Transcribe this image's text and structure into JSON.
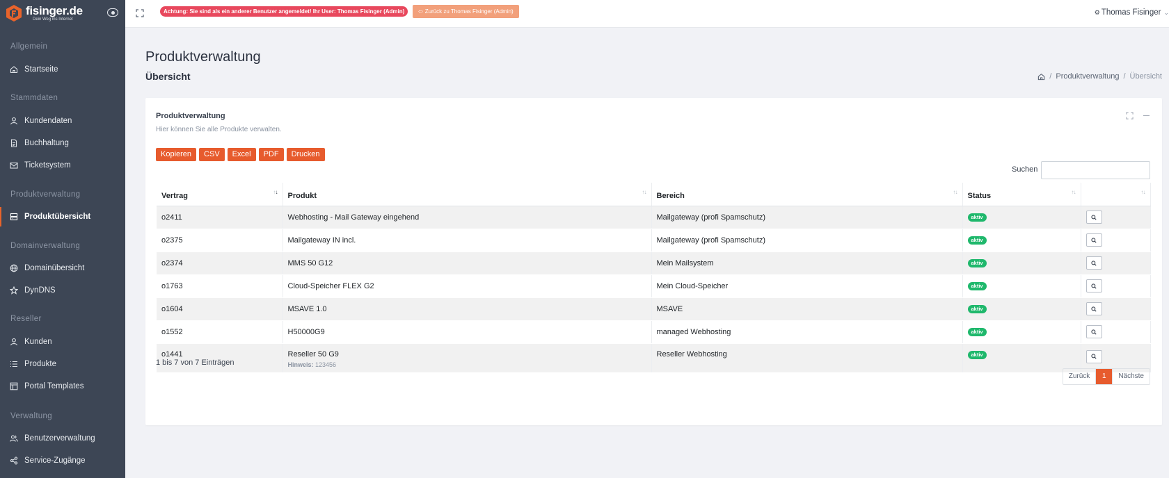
{
  "brand": {
    "name": "fisinger.de",
    "tagline": "Dein Weg ins Internet"
  },
  "topbar": {
    "warning": "Achtung: Sie sind als ein anderer Benutzer angemeldet! Ihr User: Thomas Fisinger (Admin)",
    "back_button": "Zurück zu Thomas Fisinger (Admin)",
    "user": "Thomas Fisinger"
  },
  "sidebar": {
    "sections": [
      {
        "label": "Allgemein"
      },
      {
        "label": "Stammdaten"
      },
      {
        "label": "Produktverwaltung"
      },
      {
        "label": "Domainverwaltung"
      },
      {
        "label": "Reseller"
      },
      {
        "label": "Verwaltung"
      }
    ],
    "items": [
      {
        "label": "Startseite",
        "icon": "home-icon"
      },
      {
        "label": "Kundendaten",
        "icon": "user-icon"
      },
      {
        "label": "Buchhaltung",
        "icon": "document-icon"
      },
      {
        "label": "Ticketsystem",
        "icon": "mail-icon"
      },
      {
        "label": "Produktübersicht",
        "icon": "server-icon",
        "active": true
      },
      {
        "label": "Domainübersicht",
        "icon": "globe-icon"
      },
      {
        "label": "DynDNS",
        "icon": "star-icon"
      },
      {
        "label": "Kunden",
        "icon": "user-icon"
      },
      {
        "label": "Produkte",
        "icon": "list-icon"
      },
      {
        "label": "Portal Templates",
        "icon": "layout-icon"
      },
      {
        "label": "Benutzerverwaltung",
        "icon": "users-icon"
      },
      {
        "label": "Service-Zugänge",
        "icon": "share-icon"
      }
    ]
  },
  "page": {
    "title": "Produktverwaltung",
    "subtitle": "Übersicht",
    "breadcrumb": [
      "Produktverwaltung",
      "Übersicht"
    ]
  },
  "card": {
    "title": "Produktverwaltung",
    "description": "Hier können Sie alle Produkte verwalten.",
    "export_buttons": [
      "Kopieren",
      "CSV",
      "Excel",
      "PDF",
      "Drucken"
    ],
    "search_label": "Suchen",
    "search_value": ""
  },
  "table": {
    "columns": [
      "Vertrag",
      "Produkt",
      "Bereich",
      "Status",
      ""
    ],
    "rows": [
      {
        "vertrag": "o2411",
        "produkt": "Webhosting - Mail Gateway eingehend",
        "bereich": "Mailgateway (profi Spamschutz)",
        "status": "aktiv"
      },
      {
        "vertrag": "o2375",
        "produkt": "Mailgateway IN incl.",
        "bereich": "Mailgateway (profi Spamschutz)",
        "status": "aktiv"
      },
      {
        "vertrag": "o2374",
        "produkt": "MMS 50 G12",
        "bereich": "Mein Mailsystem",
        "status": "aktiv"
      },
      {
        "vertrag": "o1763",
        "produkt": "Cloud-Speicher FLEX G2",
        "bereich": "Mein Cloud-Speicher",
        "status": "aktiv"
      },
      {
        "vertrag": "o1604",
        "produkt": "MSAVE 1.0",
        "bereich": "MSAVE",
        "status": "aktiv"
      },
      {
        "vertrag": "o1552",
        "produkt": "H50000G9",
        "bereich": "managed Webhosting",
        "status": "aktiv"
      },
      {
        "vertrag": "o1441",
        "produkt": "Reseller 50 G9",
        "hint_label": "Hinweis:",
        "hint_value": "123456",
        "bereich": "Reseller Webhosting",
        "status": "aktiv"
      }
    ],
    "info": "1 bis 7 von 7 Einträgen"
  },
  "pagination": {
    "prev": "Zurück",
    "page": "1",
    "next": "Nächste"
  },
  "colors": {
    "accent": "#e75b2d",
    "sidebar": "#3d4655",
    "success": "#1fb86c",
    "danger": "#e8485d"
  }
}
